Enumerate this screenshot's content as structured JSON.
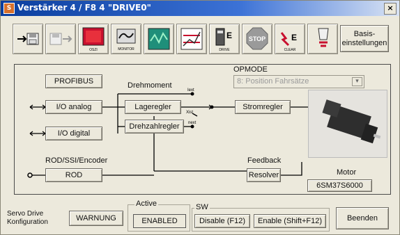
{
  "window": {
    "title": "Verstärker 4 / F8 4 \"DRIVE0\"",
    "close": "×"
  },
  "toolbar": {
    "items": [
      {
        "name": "save-to-drive-icon",
        "label": ""
      },
      {
        "name": "load-from-drive-icon",
        "label": ""
      },
      {
        "name": "oscilloscope-icon",
        "label": "OSZI"
      },
      {
        "name": "monitor-icon",
        "label": "MONITOR"
      },
      {
        "name": "signal-icon",
        "label": ""
      },
      {
        "name": "chart-icon",
        "label": ""
      },
      {
        "name": "drive-icon",
        "label": "DRIVE"
      },
      {
        "name": "stop-icon",
        "label": "STOP"
      },
      {
        "name": "clear-icon",
        "label": "CLEAR"
      },
      {
        "name": "drive-reset-icon",
        "label": ""
      }
    ],
    "basis_label": "Basis-\neinstellungen"
  },
  "diagram": {
    "profibus": "PROFIBUS",
    "io_analog": "I/O analog",
    "io_digital": "I/O digital",
    "rod_encoder": "ROD/SSI/Encoder",
    "rod": "ROD",
    "drehmoment": "Drehmoment",
    "lageregler": "Lageregler",
    "drehzahlregler": "Drehzahlregler",
    "stromregler": "Stromregler",
    "feedback": "Feedback",
    "resolver": "Resolver",
    "opmode_label": "OPMODE",
    "opmode_value": "8: Position Fahrsätze",
    "motor_label": "Motor",
    "motor_value": "6SM37S6000",
    "i_ext": "Iext",
    "x_ist": "Xist",
    "n_ext": "next"
  },
  "bottom": {
    "servo_label": "Servo Drive\nKonfiguration",
    "warnung": "WARNUNG",
    "active_title": "Active",
    "enabled": "ENABLED",
    "sw_title": "SW",
    "disable": "Disable (F12)",
    "enable": "Enable (Shift+F12)",
    "beenden": "Beenden"
  }
}
